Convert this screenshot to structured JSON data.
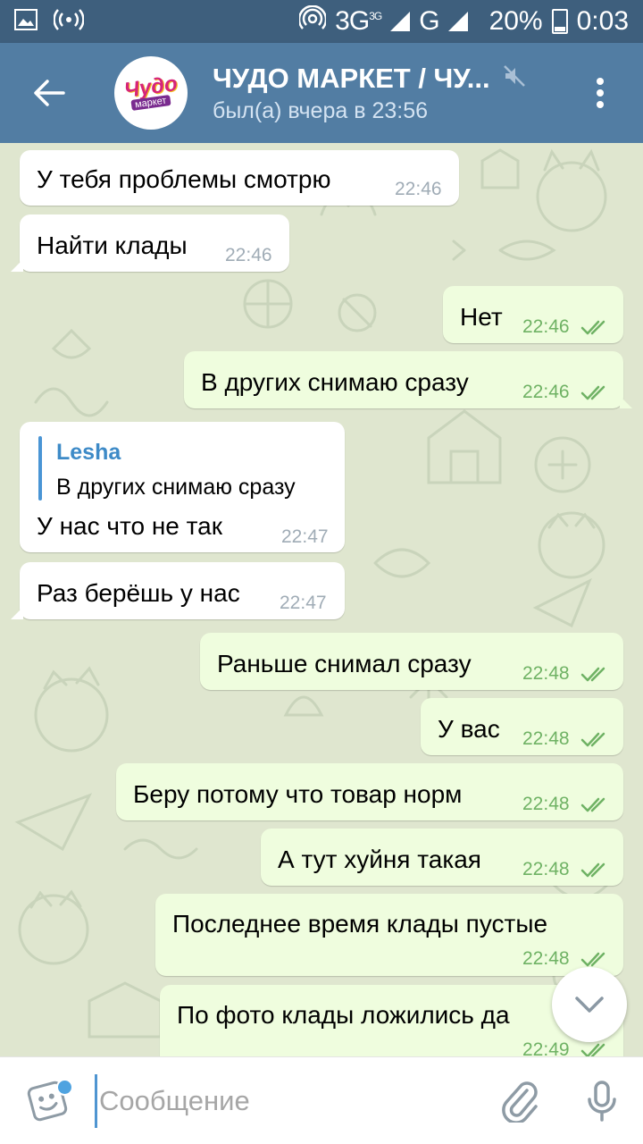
{
  "status_bar": {
    "network_3g": "3G",
    "network_3g_sup": "3G",
    "network_g": "G",
    "battery": "20%",
    "battery_badge": "20",
    "clock": "0:03"
  },
  "header": {
    "title": "ЧУДО МАРКЕТ / ЧУ...",
    "status": "был(а) вчера в 23:56",
    "avatar_line1": "Чудо",
    "avatar_line2": "маркет"
  },
  "messages": [
    {
      "direction": "in",
      "text": "У тебя проблемы смотрю",
      "time": "22:46"
    },
    {
      "direction": "in",
      "text": "Найти клады",
      "time": "22:46"
    },
    {
      "direction": "out",
      "text": "Нет",
      "time": "22:46",
      "read": true
    },
    {
      "direction": "out",
      "text": "В других снимаю сразу",
      "time": "22:46",
      "read": true
    },
    {
      "direction": "in",
      "reply_name": "Lesha",
      "reply_text": "В других снимаю сразу",
      "text": "У нас что не так",
      "time": "22:47"
    },
    {
      "direction": "in",
      "text": "Раз берёшь у нас",
      "time": "22:47"
    },
    {
      "direction": "out",
      "text": "Раньше снимал сразу",
      "time": "22:48",
      "read": true
    },
    {
      "direction": "out",
      "text": "У вас",
      "time": "22:48",
      "read": true
    },
    {
      "direction": "out",
      "text": "Беру потому что товар норм",
      "time": "22:48",
      "read": true
    },
    {
      "direction": "out",
      "text": "А тут хуйня такая",
      "time": "22:48",
      "read": true
    },
    {
      "direction": "out",
      "text": "Последнее время клады пустые",
      "time": "22:48",
      "read": true
    },
    {
      "direction": "out",
      "text": "По фото клады ложились да",
      "time": "22:49",
      "read": true
    }
  ],
  "composer": {
    "placeholder": "Сообщение",
    "value": ""
  },
  "colors": {
    "status_bar": "#3e5f7d",
    "header": "#527da3",
    "incoming_bubble": "#ffffff",
    "outgoing_bubble": "#effdde",
    "outgoing_time": "#6fb264",
    "accent": "#4a95d5"
  },
  "icons": [
    "image-icon",
    "hotspot-icon",
    "wifi-icon",
    "signal-icon",
    "battery-icon",
    "back-arrow-icon",
    "mute-icon",
    "more-vert-icon",
    "double-check-icon",
    "chevron-down-icon",
    "sticker-icon",
    "paperclip-icon",
    "mic-icon"
  ]
}
